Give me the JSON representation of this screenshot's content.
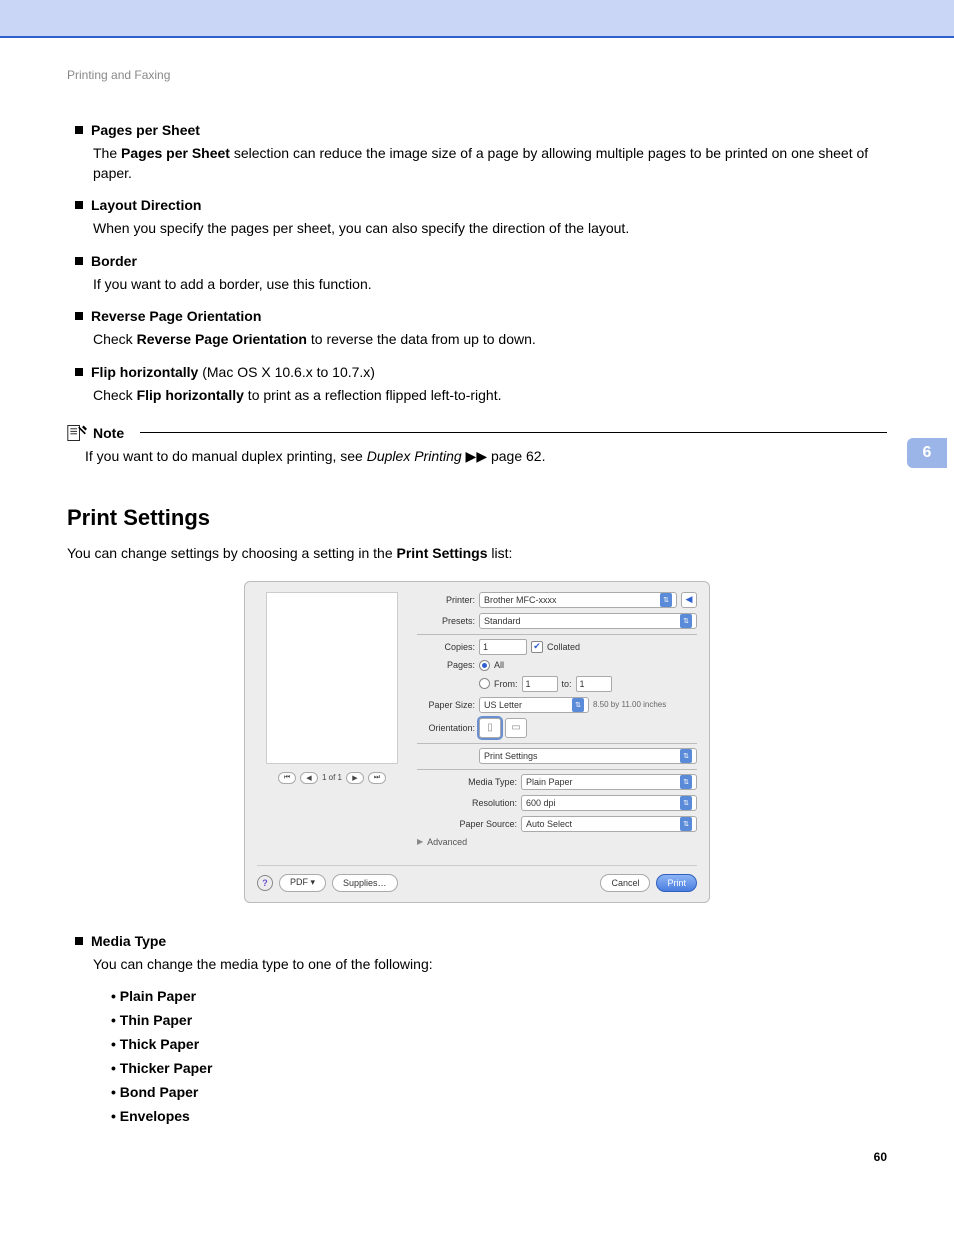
{
  "chapterHeader": "Printing and Faxing",
  "tabNumber": "6",
  "pageNumber": "60",
  "features": {
    "pagesPerSheet": {
      "title": "Pages per Sheet",
      "desc_a": "The ",
      "desc_bold": "Pages per Sheet",
      "desc_b": " selection can reduce the image size of a page by allowing multiple pages to be printed on one sheet of paper."
    },
    "layoutDirection": {
      "title": "Layout Direction",
      "desc": "When you specify the pages per sheet, you can also specify the direction of the layout."
    },
    "border": {
      "title": "Border",
      "desc": "If you want to add a border, use this function."
    },
    "reverse": {
      "title": "Reverse Page Orientation",
      "desc_a": "Check ",
      "desc_bold": "Reverse Page Orientation",
      "desc_b": " to reverse the data from up to down."
    },
    "flip": {
      "title": "Flip horizontally",
      "title_suffix": " (Mac OS X 10.6.x to 10.7.x)",
      "desc_a": "Check ",
      "desc_bold": "Flip horizontally",
      "desc_b": " to print as a reflection flipped left-to-right."
    }
  },
  "note": {
    "label": "Note",
    "text_a": "If you want to do manual duplex printing, see ",
    "text_italic": "Duplex Printing",
    "text_b": " ▶▶ page 62."
  },
  "section": {
    "title": "Print Settings",
    "intro_a": "You can change settings by choosing a setting in the ",
    "intro_bold": "Print Settings",
    "intro_b": " list:"
  },
  "dialog": {
    "printerLabel": "Printer:",
    "printerValue": "Brother MFC-xxxx",
    "presetsLabel": "Presets:",
    "presetsValue": "Standard",
    "copiesLabel": "Copies:",
    "copiesValue": "1",
    "collatedLabel": "Collated",
    "pagesLabel": "Pages:",
    "allLabel": "All",
    "fromLabel": "From:",
    "fromValue": "1",
    "toLabel": "to:",
    "toValue": "1",
    "paperSizeLabel": "Paper Size:",
    "paperSizeValue": "US Letter",
    "paperDims": "8.50 by 11.00 inches",
    "orientationLabel": "Orientation:",
    "panelValue": "Print Settings",
    "mediaTypeLabel": "Media Type:",
    "mediaTypeValue": "Plain Paper",
    "resolutionLabel": "Resolution:",
    "resolutionValue": "600 dpi",
    "paperSourceLabel": "Paper Source:",
    "paperSourceValue": "Auto Select",
    "advanced": "Advanced",
    "pdfBtn": "PDF ▾",
    "suppliesBtn": "Supplies…",
    "cancelBtn": "Cancel",
    "printBtn": "Print",
    "pager": "1 of 1"
  },
  "mediaType": {
    "title": "Media Type",
    "desc": "You can change the media type to one of the following:",
    "items": [
      "Plain Paper",
      "Thin Paper",
      "Thick Paper",
      "Thicker Paper",
      "Bond Paper",
      "Envelopes"
    ]
  }
}
